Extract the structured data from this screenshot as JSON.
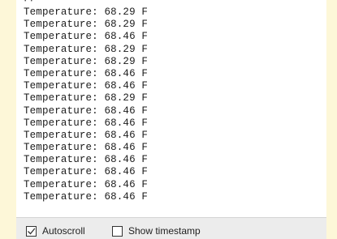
{
  "serial_monitor": {
    "partial_top_line": "·  ·",
    "lines": [
      "Temperature: 68.29 F",
      "Temperature: 68.29 F",
      "Temperature: 68.46 F",
      "Temperature: 68.29 F",
      "Temperature: 68.29 F",
      "Temperature: 68.46 F",
      "Temperature: 68.46 F",
      "Temperature: 68.29 F",
      "Temperature: 68.46 F",
      "Temperature: 68.46 F",
      "Temperature: 68.46 F",
      "Temperature: 68.46 F",
      "Temperature: 68.46 F",
      "Temperature: 68.46 F",
      "Temperature: 68.46 F",
      "Temperature: 68.46 F"
    ]
  },
  "controls": {
    "autoscroll": {
      "label": "Autoscroll",
      "checked": true,
      "icon": "checkmark-icon"
    },
    "show_timestamp": {
      "label": "Show timestamp",
      "checked": false
    }
  },
  "colors": {
    "page_background": "#fdf7d8",
    "output_background": "#ffffff",
    "bottom_bar_background": "#ececec",
    "text": "#1c1c1c"
  }
}
